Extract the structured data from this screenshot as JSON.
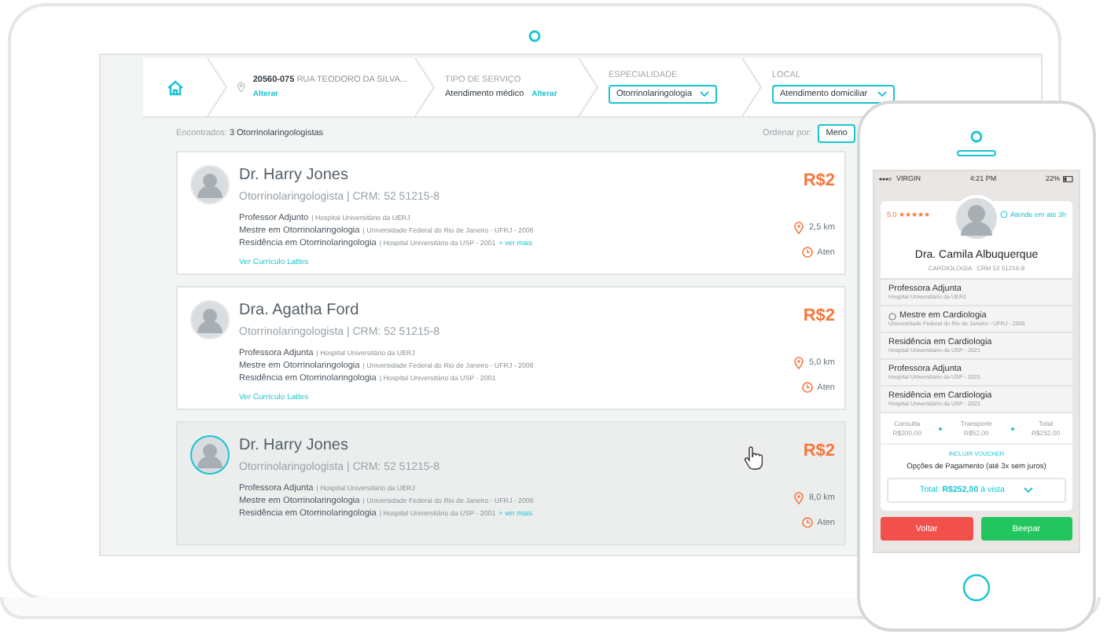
{
  "laptop": {
    "header": {
      "address": {
        "code": "20560-075",
        "street": "RUA TEODORO DA SILVA...",
        "action": "Alterar"
      },
      "service": {
        "label": "TIPO DE SERVIÇO",
        "value": "Atendimento médico",
        "action": "Alterar"
      },
      "specialty": {
        "label": "ESPECIALIDADE",
        "value": "Otorrinolaringologia"
      },
      "location": {
        "label": "LOCAL",
        "value": "Atendimento domiciliar"
      }
    },
    "results": {
      "summary": "Encontrados: **3 Otorrinolaringologistas**",
      "sort_label": "Ordenar por:",
      "sort_value": "Meno"
    },
    "doctors": [
      {
        "name": "Dr. Harry Jones",
        "specialty": "Otorrinolaringologista | CRM: 52 51215-8",
        "hovered": false,
        "credentials": [
          {
            "title": "Professor Adjunto",
            "detail": "| Hospital Universitário da UERJ"
          },
          {
            "title": "Mestre em Otorrinolaringologia",
            "detail": "| Universidade Federal do Rio de Janeiro - UFRJ - 2006"
          },
          {
            "title": "Residência em Otorrinolaringologia",
            "detail": "| Hospital Universitário da USP - 2001"
          }
        ],
        "more": "+ ver mais",
        "cv_link": "Ver Currículo Lattes",
        "price": "R$2",
        "distance": "2,5 km",
        "availability": "Aten"
      },
      {
        "name": "Dra. Agatha Ford",
        "specialty": "Otorrinolaringologista | CRM: 52 51215-8",
        "hovered": false,
        "credentials": [
          {
            "title": "Professora Adjunta",
            "detail": "| Hospital Universitário da UERJ"
          },
          {
            "title": "Mestre em Otorrinolaringologia",
            "detail": "| Universidade Federal do Rio de Janeiro - UFRJ - 2006"
          },
          {
            "title": "Residência em Otorrinolaringologia",
            "detail": "| Hospital Universitário da USP - 2001"
          }
        ],
        "cv_link": "Ver Currículo Lattes",
        "price": "R$2",
        "distance": "5,0 km",
        "availability": "Aten"
      },
      {
        "name": "Dr. Harry Jones",
        "specialty": "Otorrinolaringologista | CRM: 52 51215-8",
        "hovered": true,
        "credentials": [
          {
            "title": "Professora Adjunta",
            "detail": "| Hospital Universitário da UERJ"
          },
          {
            "title": "Mestre em Otorrinolaringologia",
            "detail": "| Universidade Federal do Rio de Janeiro - UFRJ - 2006"
          },
          {
            "title": "Residência em Otorrinolaringologia",
            "detail": "| Hospital Universitário da USP - 2001"
          }
        ],
        "more": "+ ver mais",
        "price": "R$2",
        "distance": "8,0 km",
        "availability": "Aten"
      }
    ]
  },
  "phone": {
    "status": {
      "carrier": "VIRGIN",
      "time": "4:21 PM",
      "battery": "22%"
    },
    "profile": {
      "rating": "5.0",
      "stars": 5,
      "response": "Atende em até 3h",
      "name": "Dra. Camila Albuquerque",
      "specialty": "CARDIOLOGIA",
      "crm": "CRM 52 51216-8"
    },
    "credentials": [
      {
        "kind": "plain",
        "title": "Professora Adjunta",
        "detail": "Hospital Universitário da UERJ"
      },
      {
        "kind": "option",
        "title": "Mestre em Cardiologia",
        "detail": "Universidade Federal do Rio de Janeiro - UFRJ - 2006"
      },
      {
        "kind": "plain",
        "title": "Residência em Cardiologia",
        "detail": "Hospital Universitário da USP - 2021"
      },
      {
        "kind": "plain",
        "title": "Professora Adjunta",
        "detail": "Hospital Universitário da USP - 2021"
      },
      {
        "kind": "plain",
        "title": "Residência em Cardiologia",
        "detail": "Hospital Universitário da USP - 2021"
      }
    ],
    "costs": [
      {
        "label": "Consulta",
        "value": "R$200,00"
      },
      {
        "label": "Transporte",
        "value": "R$52,00"
      },
      {
        "label": "Total",
        "value": "R$252,00"
      }
    ],
    "voucher": "INCLUIR VOUCHER",
    "payment_title": "Opções de Pagamento (até 3x sem juros)",
    "payment_select": "Total: **R$252,00** à vista",
    "buttons": [
      {
        "label": "Voltar",
        "kind": "secondary"
      },
      {
        "label": "Beepar",
        "kind": "primary"
      }
    ]
  }
}
